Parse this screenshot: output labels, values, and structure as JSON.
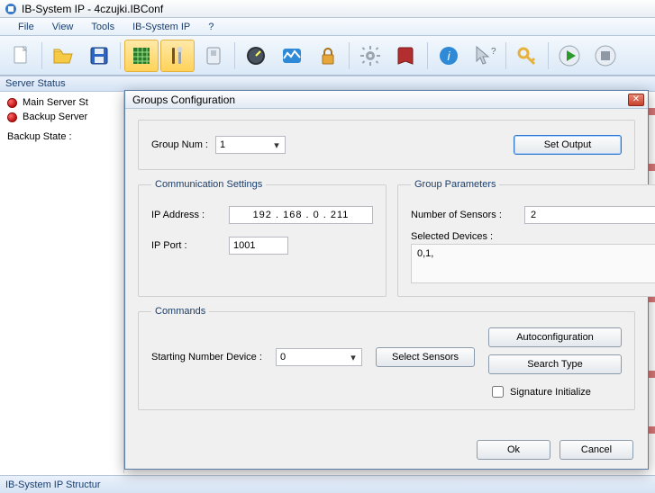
{
  "window": {
    "title": "IB-System IP - 4czujki.IBConf"
  },
  "menu": {
    "file": "File",
    "view": "View",
    "tools": "Tools",
    "ibsystem": "IB-System IP",
    "help": "?"
  },
  "server_status": {
    "tab_label": "Server Status",
    "main_status": "Main Server St",
    "backup_server": "Backup Server",
    "backup_state_label": "Backup State :"
  },
  "bottom": {
    "structure": "IB-System IP Structur"
  },
  "dialog": {
    "title": "Groups Configuration",
    "group_section": {
      "group_num_label": "Group Num :",
      "group_num_value": "1",
      "set_output": "Set Output"
    },
    "comm": {
      "legend": "Communication Settings",
      "ip_addr_label": "IP Address :",
      "ip_addr_value": "192  .  168  .   0   .  211",
      "ip_port_label": "IP Port :",
      "ip_port_value": "1001"
    },
    "group_params": {
      "legend": "Group Parameters",
      "num_sensors_label": "Number of Sensors :",
      "num_sensors_value": "2",
      "selected_devices_label": "Selected Devices :",
      "selected_devices_value": "0,1,"
    },
    "commands": {
      "legend": "Commands",
      "starting_num_label": "Starting Number Device :",
      "starting_num_value": "0",
      "select_sensors": "Select Sensors",
      "autoconfig": "Autoconfiguration",
      "search_type": "Search Type",
      "signature_init": "Signature Initialize"
    },
    "footer": {
      "ok": "Ok",
      "cancel": "Cancel"
    }
  }
}
